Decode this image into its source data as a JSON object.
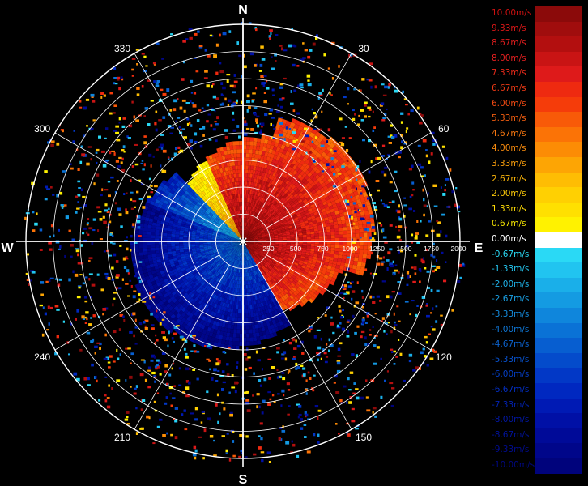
{
  "display": {
    "compass": {
      "north": "N",
      "south": "S",
      "east": "E",
      "west": "W"
    },
    "bearing_labels": [
      {
        "deg": 30,
        "label": "30"
      },
      {
        "deg": 60,
        "label": "60"
      },
      {
        "deg": 120,
        "label": "120"
      },
      {
        "deg": 150,
        "label": "150"
      },
      {
        "deg": 210,
        "label": "210"
      },
      {
        "deg": 240,
        "label": "240"
      },
      {
        "deg": 300,
        "label": "300"
      },
      {
        "deg": 330,
        "label": "330"
      }
    ],
    "range_labels": [
      "250",
      "500",
      "750",
      "1000",
      "1250",
      "1500",
      "1750",
      "2000"
    ],
    "colors": {
      "background": "#000000",
      "grid": "#ffffff",
      "zero": "#ffffff"
    }
  },
  "legend": {
    "units": "m/s",
    "items": [
      {
        "label": "10.00m/s",
        "color": "#8b0a0a",
        "text_color": "#cc1111"
      },
      {
        "label": "9.33m/s",
        "color": "#a00d0d",
        "text_color": "#dd1818"
      },
      {
        "label": "8.67m/s",
        "color": "#b30f0f",
        "text_color": "#e01d1d"
      },
      {
        "label": "8.00m/s",
        "color": "#c91414",
        "text_color": "#e52020"
      },
      {
        "label": "7.33m/s",
        "color": "#de1a1a",
        "text_color": "#ea2a1a"
      },
      {
        "label": "6.67m/s",
        "color": "#ee2a10",
        "text_color": "#ee3a15"
      },
      {
        "label": "6.00m/s",
        "color": "#f53c0a",
        "text_color": "#f24a12"
      },
      {
        "label": "5.33m/s",
        "color": "#f85a08",
        "text_color": "#f45e10"
      },
      {
        "label": "4.67m/s",
        "color": "#fb7306",
        "text_color": "#f5760f"
      },
      {
        "label": "4.00m/s",
        "color": "#fc8c05",
        "text_color": "#f78a0d"
      },
      {
        "label": "3.33m/s",
        "color": "#fda504",
        "text_color": "#f89e0c"
      },
      {
        "label": "2.67m/s",
        "color": "#febd03",
        "text_color": "#f9b40a"
      },
      {
        "label": "2.00m/s",
        "color": "#ffd002",
        "text_color": "#fac808"
      },
      {
        "label": "1.33m/s",
        "color": "#ffe001",
        "text_color": "#fbd806"
      },
      {
        "label": "0.67m/s",
        "color": "#fff200",
        "text_color": "#f2e200"
      },
      {
        "label": "0.00m/s",
        "color": "#ffffff",
        "text_color": "#ffffff"
      },
      {
        "label": "-0.67m/s",
        "color": "#2ad9f5",
        "text_color": "#2ad9f5"
      },
      {
        "label": "-1.33m/s",
        "color": "#21c4f0",
        "text_color": "#25c6f0"
      },
      {
        "label": "-2.00m/s",
        "color": "#1aafe9",
        "text_color": "#1fb3ea"
      },
      {
        "label": "-2.67m/s",
        "color": "#149be2",
        "text_color": "#1aa0e4"
      },
      {
        "label": "-3.33m/s",
        "color": "#0f86dc",
        "text_color": "#158cde"
      },
      {
        "label": "-4.00m/s",
        "color": "#0a72d6",
        "text_color": "#1078d8"
      },
      {
        "label": "-4.67m/s",
        "color": "#075ed0",
        "text_color": "#0c64d2"
      },
      {
        "label": "-5.33m/s",
        "color": "#044bcb",
        "text_color": "#0851cc"
      },
      {
        "label": "-6.00m/s",
        "color": "#0238c6",
        "text_color": "#053fc6"
      },
      {
        "label": "-6.67m/s",
        "color": "#0028c0",
        "text_color": "#032ec0"
      },
      {
        "label": "-7.33m/s",
        "color": "#001ab4",
        "text_color": "#0222b2"
      },
      {
        "label": "-8.00m/s",
        "color": "#0010a6",
        "text_color": "#0218a6"
      },
      {
        "label": "-8.67m/s",
        "color": "#000a98",
        "text_color": "#01129a"
      },
      {
        "label": "-9.33m/s",
        "color": "#00068a",
        "text_color": "#010c8e"
      },
      {
        "label": "-10.00m/s",
        "color": "#00037c",
        "text_color": "#010880"
      }
    ]
  }
}
